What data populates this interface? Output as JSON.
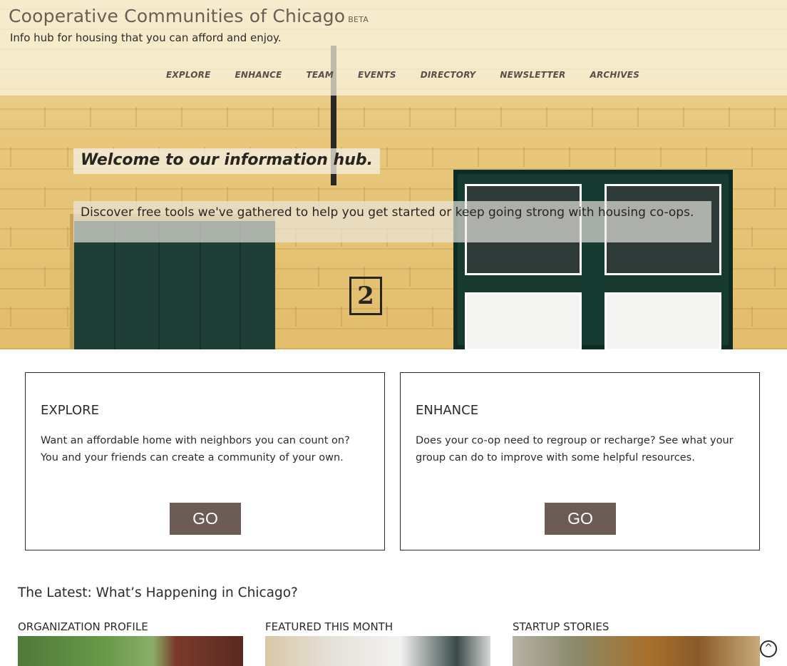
{
  "site": {
    "title": "Cooperative Communities of Chicago",
    "badge": "BETA",
    "tagline": "Info hub for housing that you can afford and enjoy."
  },
  "nav": {
    "items": [
      {
        "label": "EXPLORE"
      },
      {
        "label": "ENHANCE"
      },
      {
        "label": "TEAM"
      },
      {
        "label": "EVENTS"
      },
      {
        "label": "DIRECTORY"
      },
      {
        "label": "NEWSLETTER"
      },
      {
        "label": "ARCHIVES"
      }
    ]
  },
  "hero": {
    "heading": "Welcome to our information hub.",
    "subtext": "Discover free tools we've gathered to help you get started or keep going strong with housing co-ops.",
    "house_number": "2"
  },
  "cards": [
    {
      "title": "EXPLORE",
      "body": "Want an affordable home with neighbors you can count on? You and your friends can create a community of your own.",
      "button": "GO"
    },
    {
      "title": "ENHANCE",
      "body": "Does your co-op need to regroup or recharge? See what your group can do to improve with some helpful resources.",
      "button": "GO"
    }
  ],
  "latest": {
    "heading": "The Latest: What’s Happening in Chicago?",
    "columns": [
      {
        "label": "ORGANIZATION PROFILE"
      },
      {
        "label": "FEATURED THIS MONTH"
      },
      {
        "label": "STARTUP STORIES"
      }
    ]
  },
  "colors": {
    "accent": "#6b5d55",
    "text": "#2e2a28"
  },
  "icons": {
    "back_to_top": "chevron-up-circle-icon"
  }
}
